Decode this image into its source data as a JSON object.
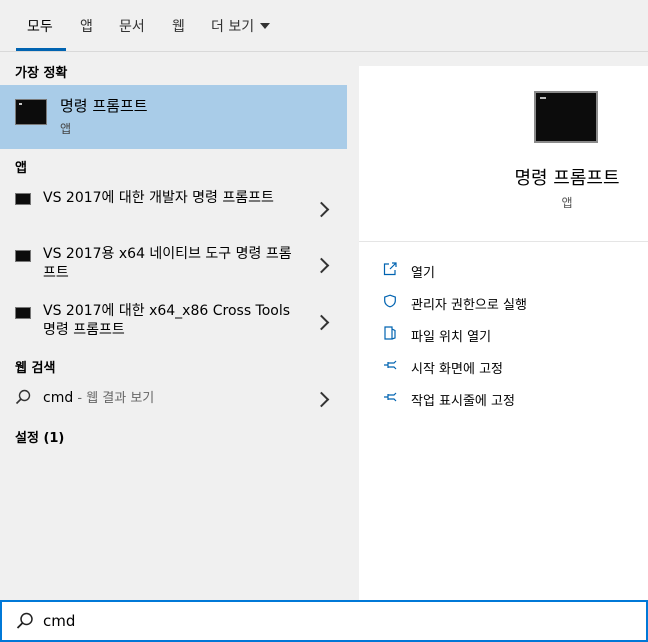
{
  "tabs": [
    {
      "label": "모두"
    },
    {
      "label": "앱"
    },
    {
      "label": "문서"
    },
    {
      "label": "웹"
    },
    {
      "label": "더 보기"
    }
  ],
  "left": {
    "best_match_header": "가장 정확",
    "best_match": {
      "title": "명령 프롬프트",
      "subtitle": "앱"
    },
    "apps_header": "앱",
    "apps": [
      {
        "label": "VS 2017에 대한 개발자 명령 프롬프트"
      },
      {
        "label": "VS 2017용 x64 네이티브 도구 명령 프롬프트"
      },
      {
        "label": "VS 2017에 대한 x64_x86 Cross Tools 명령 프롬프트"
      }
    ],
    "web_header": "웹 검색",
    "web_query": "cmd",
    "web_suffix": " - 웹 결과 보기",
    "settings_header": "설정 (1)"
  },
  "right": {
    "title": "명령 프롬프트",
    "subtitle": "앱",
    "actions": [
      {
        "label": "열기",
        "icon": "open-icon"
      },
      {
        "label": "관리자 권한으로 실행",
        "icon": "shield-icon"
      },
      {
        "label": "파일 위치 열기",
        "icon": "file-location-icon"
      },
      {
        "label": "시작 화면에 고정",
        "icon": "pin-icon"
      },
      {
        "label": "작업 표시줄에 고정",
        "icon": "pin-icon"
      }
    ]
  },
  "search": {
    "value": "cmd"
  },
  "colors": {
    "accent": "#0078d7",
    "selected": "#a9cce8",
    "tab_underline": "#0063b1"
  }
}
